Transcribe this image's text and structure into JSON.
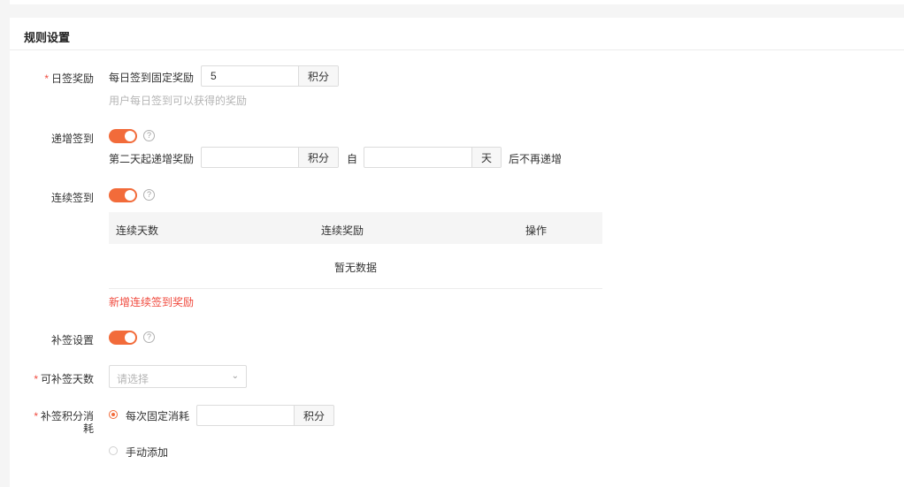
{
  "section_title": "规则设置",
  "daily_reward": {
    "label": "日签奖励",
    "prefix": "每日签到固定奖励",
    "value": "5",
    "unit": "积分",
    "hint": "用户每日签到可以获得的奖励"
  },
  "incremental": {
    "label": "递增签到",
    "enabled": true,
    "prefix": "第二天起递增奖励",
    "reward_value": "",
    "reward_unit": "积分",
    "from_label": "自",
    "days_value": "",
    "days_unit": "天",
    "suffix": "后不再递增"
  },
  "continuous": {
    "label": "连续签到",
    "enabled": true,
    "columns": [
      "连续天数",
      "连续奖励",
      "操作"
    ],
    "empty_text": "暂无数据",
    "add_link": "新增连续签到奖励"
  },
  "makeup": {
    "label": "补签设置",
    "enabled": true
  },
  "makeup_days": {
    "label": "可补签天数",
    "placeholder": "请选择"
  },
  "makeup_cost": {
    "label_line1": "补签积分消",
    "label_line2": "耗",
    "option_fixed": "每次固定消耗",
    "fixed_value": "",
    "fixed_unit": "积分",
    "option_manual": "手动添加"
  },
  "colors": {
    "accent": "#f26b3a",
    "required": "#f04a3e"
  }
}
